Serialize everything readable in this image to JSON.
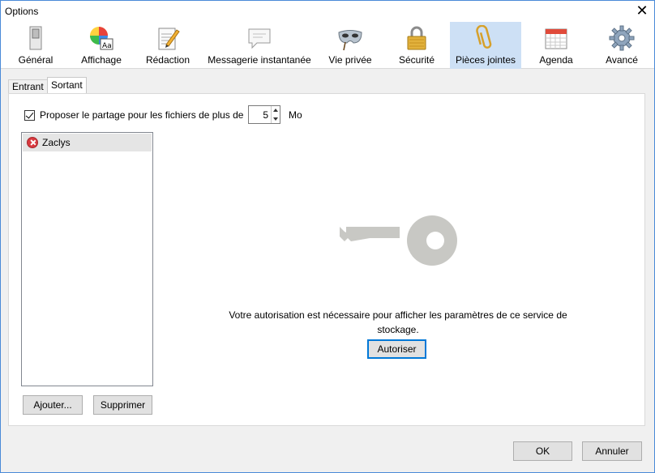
{
  "window": {
    "title": "Options",
    "close_glyph": "✕"
  },
  "toolbar": {
    "panes": [
      {
        "label": "Général",
        "icon": "switch-icon"
      },
      {
        "label": "Affichage",
        "icon": "color-wheel-icon"
      },
      {
        "label": "Rédaction",
        "icon": "notepad-pencil-icon"
      },
      {
        "label": "Messagerie instantanée",
        "icon": "chat-bubble-icon"
      },
      {
        "label": "Vie privée",
        "icon": "mask-icon"
      },
      {
        "label": "Sécurité",
        "icon": "padlock-icon"
      },
      {
        "label": "Pièces jointes",
        "icon": "paperclip-icon",
        "selected": true
      },
      {
        "label": "Agenda",
        "icon": "calendar-icon"
      },
      {
        "label": "Avancé",
        "icon": "gear-icon"
      }
    ]
  },
  "subtabs": [
    {
      "label": "Entrant"
    },
    {
      "label": "Sortant",
      "active": true
    }
  ],
  "outgoing": {
    "offer_share_label": "Proposer le partage pour les fichiers de plus de",
    "offer_share_checked": true,
    "threshold_value": "5",
    "threshold_unit": "Mo",
    "accounts": [
      {
        "name": "Zaclys",
        "status": "error"
      }
    ],
    "add_label": "Ajouter...",
    "remove_label": "Supprimer",
    "auth_message": "Votre autorisation est nécessaire pour afficher les paramètres de ce service de stockage.",
    "authorize_label": "Autoriser"
  },
  "footer": {
    "ok_label": "OK",
    "cancel_label": "Annuler"
  },
  "colors": {
    "selected_pane": "#cde0f5",
    "key_gray": "#c8c8c4",
    "focus_blue": "#0078d7"
  }
}
